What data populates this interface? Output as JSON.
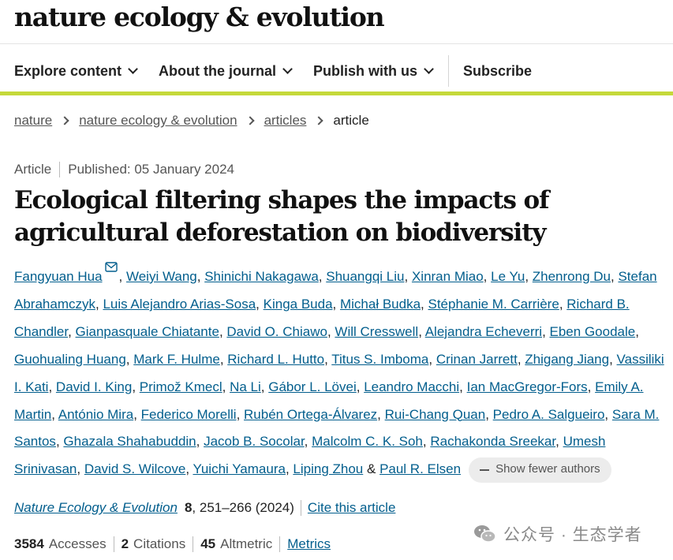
{
  "header": {
    "journal_name": "nature ecology & evolution"
  },
  "nav": {
    "explore": "Explore content",
    "about": "About the journal",
    "publish": "Publish with us",
    "subscribe": "Subscribe"
  },
  "breadcrumb": {
    "items": [
      "nature",
      "nature ecology & evolution",
      "articles"
    ],
    "current": "article"
  },
  "article": {
    "type": "Article",
    "published": "Published: 05 January 2024",
    "title": "Ecological filtering shapes the impacts of agricultural deforestation on biodiversity"
  },
  "authors": [
    "Fangyuan Hua",
    "Weiyi Wang",
    "Shinichi Nakagawa",
    "Shuangqi Liu",
    "Xinran Miao",
    "Le Yu",
    "Zhenrong Du",
    "Stefan Abrahamczyk",
    "Luis Alejandro Arias-Sosa",
    "Kinga Buda",
    "Michał Budka",
    "Stéphanie M. Carrière",
    "Richard B. Chandler",
    "Gianpasquale Chiatante",
    "David O. Chiawo",
    "Will Cresswell",
    "Alejandra Echeverri",
    "Eben Goodale",
    "Guohualing Huang",
    "Mark F. Hulme",
    "Richard L. Hutto",
    "Titus S. Imboma",
    "Crinan Jarrett",
    "Zhigang Jiang",
    "Vassiliki I. Kati",
    "David I. King",
    "Primož Kmecl",
    "Na Li",
    "Gábor L. Lövei",
    "Leandro Macchi",
    "Ian MacGregor-Fors",
    "Emily A. Martin",
    "António Mira",
    "Federico Morelli",
    "Rubén Ortega-Álvarez",
    "Rui-Chang Quan",
    "Pedro A. Salgueiro",
    "Sara M. Santos",
    "Ghazala Shahabuddin",
    "Jacob B. Socolar",
    "Malcolm C. K. Soh",
    "Rachakonda Sreekar",
    "Umesh Srinivasan",
    "David S. Wilcove",
    "Yuichi Yamaura",
    "Liping Zhou",
    "Paul R. Elsen"
  ],
  "authors_ampersand": "&",
  "show_fewer": "Show fewer authors",
  "citation": {
    "journal": "Nature Ecology & Evolution",
    "volume": "8",
    "pages": ", 251–266 (2024)",
    "cite_link": "Cite this article"
  },
  "metrics": {
    "accesses_count": "3584",
    "accesses_label": "Accesses",
    "citations_count": "2",
    "citations_label": "Citations",
    "altmetric_count": "45",
    "altmetric_label": "Altmetric",
    "metrics_link": "Metrics"
  },
  "watermark": "公众号 · 生态学者",
  "colors": {
    "accent_green": "#c5d93a",
    "link_blue": "#025e8d"
  },
  "icons": [
    "chevron-down-icon",
    "chevron-right-icon",
    "mail-icon",
    "minus-icon",
    "wechat-icon"
  ]
}
